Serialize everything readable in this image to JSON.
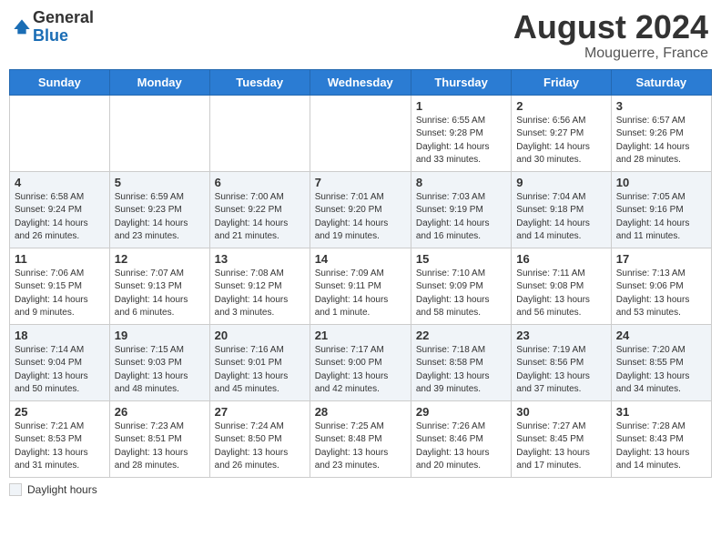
{
  "header": {
    "logo_general": "General",
    "logo_blue": "Blue",
    "month_year": "August 2024",
    "location": "Mouguerre, France"
  },
  "days_of_week": [
    "Sunday",
    "Monday",
    "Tuesday",
    "Wednesday",
    "Thursday",
    "Friday",
    "Saturday"
  ],
  "weeks": [
    [
      {
        "day": "",
        "info": ""
      },
      {
        "day": "",
        "info": ""
      },
      {
        "day": "",
        "info": ""
      },
      {
        "day": "",
        "info": ""
      },
      {
        "day": "1",
        "info": "Sunrise: 6:55 AM\nSunset: 9:28 PM\nDaylight: 14 hours\nand 33 minutes."
      },
      {
        "day": "2",
        "info": "Sunrise: 6:56 AM\nSunset: 9:27 PM\nDaylight: 14 hours\nand 30 minutes."
      },
      {
        "day": "3",
        "info": "Sunrise: 6:57 AM\nSunset: 9:26 PM\nDaylight: 14 hours\nand 28 minutes."
      }
    ],
    [
      {
        "day": "4",
        "info": "Sunrise: 6:58 AM\nSunset: 9:24 PM\nDaylight: 14 hours\nand 26 minutes."
      },
      {
        "day": "5",
        "info": "Sunrise: 6:59 AM\nSunset: 9:23 PM\nDaylight: 14 hours\nand 23 minutes."
      },
      {
        "day": "6",
        "info": "Sunrise: 7:00 AM\nSunset: 9:22 PM\nDaylight: 14 hours\nand 21 minutes."
      },
      {
        "day": "7",
        "info": "Sunrise: 7:01 AM\nSunset: 9:20 PM\nDaylight: 14 hours\nand 19 minutes."
      },
      {
        "day": "8",
        "info": "Sunrise: 7:03 AM\nSunset: 9:19 PM\nDaylight: 14 hours\nand 16 minutes."
      },
      {
        "day": "9",
        "info": "Sunrise: 7:04 AM\nSunset: 9:18 PM\nDaylight: 14 hours\nand 14 minutes."
      },
      {
        "day": "10",
        "info": "Sunrise: 7:05 AM\nSunset: 9:16 PM\nDaylight: 14 hours\nand 11 minutes."
      }
    ],
    [
      {
        "day": "11",
        "info": "Sunrise: 7:06 AM\nSunset: 9:15 PM\nDaylight: 14 hours\nand 9 minutes."
      },
      {
        "day": "12",
        "info": "Sunrise: 7:07 AM\nSunset: 9:13 PM\nDaylight: 14 hours\nand 6 minutes."
      },
      {
        "day": "13",
        "info": "Sunrise: 7:08 AM\nSunset: 9:12 PM\nDaylight: 14 hours\nand 3 minutes."
      },
      {
        "day": "14",
        "info": "Sunrise: 7:09 AM\nSunset: 9:11 PM\nDaylight: 14 hours\nand 1 minute."
      },
      {
        "day": "15",
        "info": "Sunrise: 7:10 AM\nSunset: 9:09 PM\nDaylight: 13 hours\nand 58 minutes."
      },
      {
        "day": "16",
        "info": "Sunrise: 7:11 AM\nSunset: 9:08 PM\nDaylight: 13 hours\nand 56 minutes."
      },
      {
        "day": "17",
        "info": "Sunrise: 7:13 AM\nSunset: 9:06 PM\nDaylight: 13 hours\nand 53 minutes."
      }
    ],
    [
      {
        "day": "18",
        "info": "Sunrise: 7:14 AM\nSunset: 9:04 PM\nDaylight: 13 hours\nand 50 minutes."
      },
      {
        "day": "19",
        "info": "Sunrise: 7:15 AM\nSunset: 9:03 PM\nDaylight: 13 hours\nand 48 minutes."
      },
      {
        "day": "20",
        "info": "Sunrise: 7:16 AM\nSunset: 9:01 PM\nDaylight: 13 hours\nand 45 minutes."
      },
      {
        "day": "21",
        "info": "Sunrise: 7:17 AM\nSunset: 9:00 PM\nDaylight: 13 hours\nand 42 minutes."
      },
      {
        "day": "22",
        "info": "Sunrise: 7:18 AM\nSunset: 8:58 PM\nDaylight: 13 hours\nand 39 minutes."
      },
      {
        "day": "23",
        "info": "Sunrise: 7:19 AM\nSunset: 8:56 PM\nDaylight: 13 hours\nand 37 minutes."
      },
      {
        "day": "24",
        "info": "Sunrise: 7:20 AM\nSunset: 8:55 PM\nDaylight: 13 hours\nand 34 minutes."
      }
    ],
    [
      {
        "day": "25",
        "info": "Sunrise: 7:21 AM\nSunset: 8:53 PM\nDaylight: 13 hours\nand 31 minutes."
      },
      {
        "day": "26",
        "info": "Sunrise: 7:23 AM\nSunset: 8:51 PM\nDaylight: 13 hours\nand 28 minutes."
      },
      {
        "day": "27",
        "info": "Sunrise: 7:24 AM\nSunset: 8:50 PM\nDaylight: 13 hours\nand 26 minutes."
      },
      {
        "day": "28",
        "info": "Sunrise: 7:25 AM\nSunset: 8:48 PM\nDaylight: 13 hours\nand 23 minutes."
      },
      {
        "day": "29",
        "info": "Sunrise: 7:26 AM\nSunset: 8:46 PM\nDaylight: 13 hours\nand 20 minutes."
      },
      {
        "day": "30",
        "info": "Sunrise: 7:27 AM\nSunset: 8:45 PM\nDaylight: 13 hours\nand 17 minutes."
      },
      {
        "day": "31",
        "info": "Sunrise: 7:28 AM\nSunset: 8:43 PM\nDaylight: 13 hours\nand 14 minutes."
      }
    ]
  ],
  "footer": {
    "daylight_label": "Daylight hours"
  }
}
